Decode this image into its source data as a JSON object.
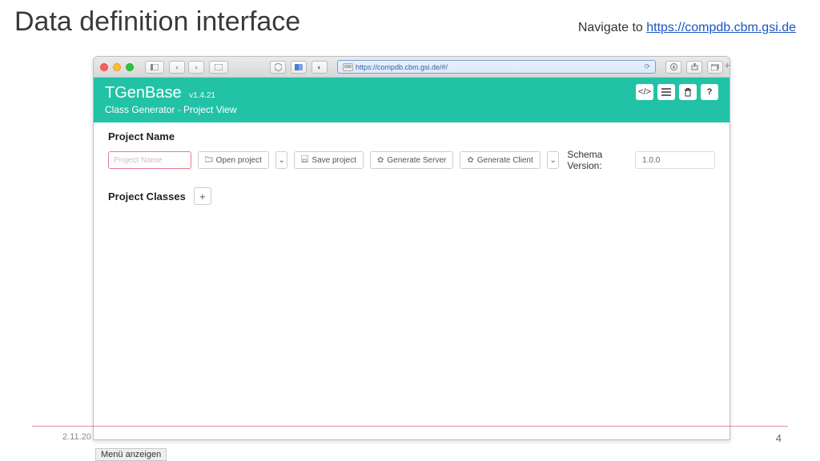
{
  "slide": {
    "title": "Data definition interface",
    "navigate_prefix": "Navigate to ",
    "navigate_url": "https://compdb.cbm.gsi.de",
    "date": "2.11.20",
    "page": "4",
    "menu_hint": "Menü anzeigen"
  },
  "browser": {
    "url_badge": "osi",
    "url": "https://compdb.cbm.gsi.de/#/",
    "tab_plus": "+"
  },
  "app": {
    "title": "TGenBase",
    "version": "v1.4.21",
    "subtitle": "Class Generator - Project View",
    "header_icons": [
      "code-icon",
      "list-icon",
      "trash-icon",
      "help-icon"
    ]
  },
  "project": {
    "name_label": "Project Name",
    "name_placeholder": "Project Name",
    "open_label": "Open project",
    "save_label": "Save project",
    "gen_server_label": "Generate Server",
    "gen_client_label": "Generate Client",
    "schema_version_label": "Schema Version:",
    "schema_version_value": "1.0.0",
    "classes_label": "Project Classes",
    "add_class_label": "+"
  }
}
